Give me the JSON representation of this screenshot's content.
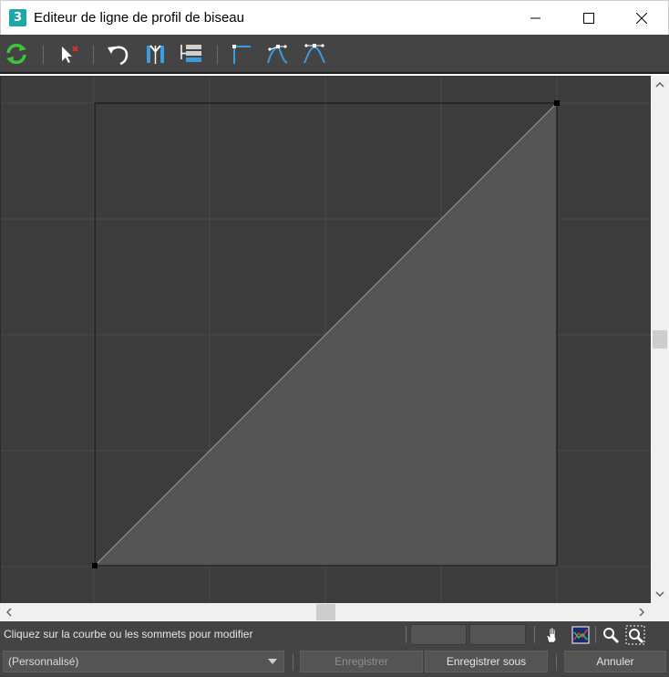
{
  "window": {
    "title": "Editeur de ligne de profil de biseau",
    "app_icon_label": "3"
  },
  "toolbar": {
    "buttons": [
      "reset-icon",
      "delete-point-icon",
      "undo-icon",
      "mirror-icon",
      "insert-icon",
      "corner-point-icon",
      "bezier-corner-icon",
      "bezier-smooth-icon"
    ]
  },
  "status": {
    "message": "Cliquez sur la courbe ou les sommets pour modifier",
    "coord_x": "",
    "coord_y": ""
  },
  "bottom": {
    "preset_value": "(Personnalisé)",
    "save_label": "Enregistrer",
    "save_as_label": "Enregistrer sous",
    "cancel_label": "Annuler"
  },
  "colors": {
    "canvas_bg": "#3c3c3c",
    "grid_line": "#4a4a4a",
    "profile_fill": "#545454",
    "profile_edge": "#9a9a9a",
    "toolbar_bg": "#444444",
    "accent_green": "#3cc43c",
    "accent_blue": "#3a9be0"
  }
}
